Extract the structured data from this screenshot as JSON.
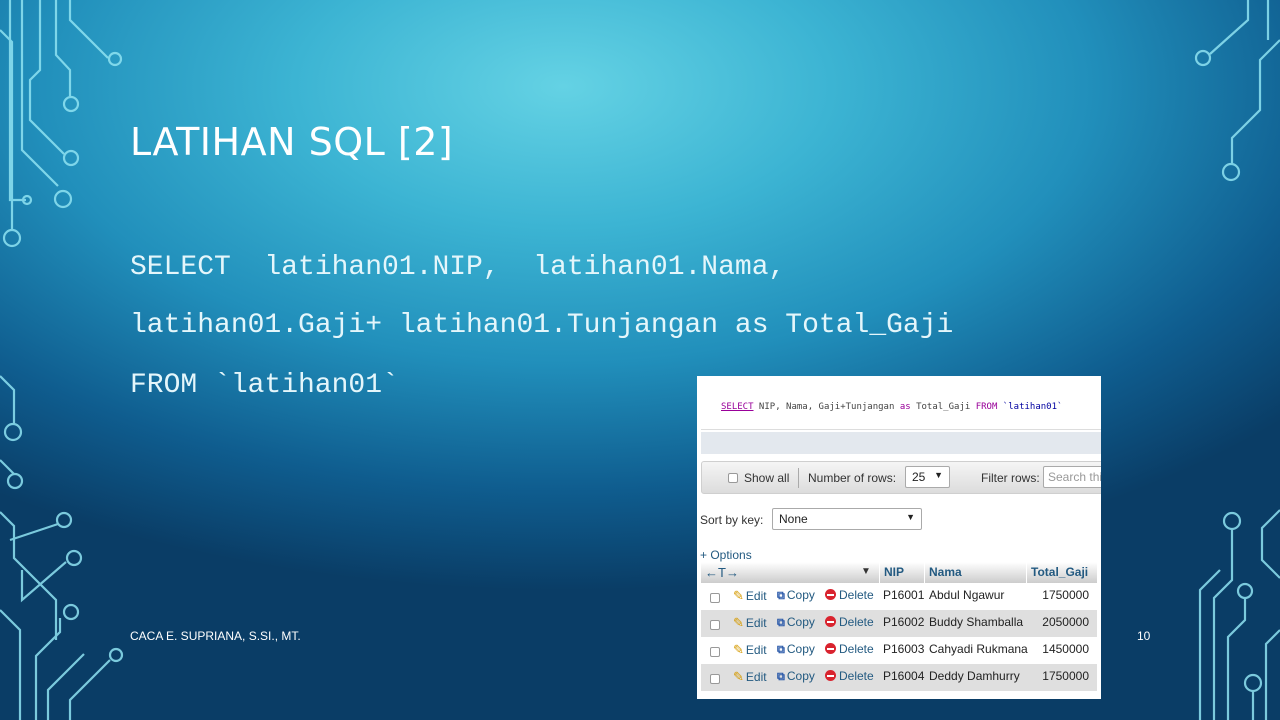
{
  "slide": {
    "title": "LATIHAN SQL [2]",
    "code_lines": [
      "SELECT  latihan01.NIP,  latihan01.Nama,",
      "latihan01.Gaji+ latihan01.Tunjangan as Total_Gaji",
      "FROM `latihan01`"
    ],
    "footer_author": "CACA E. SUPRIANA, S.SI., MT.",
    "page_number": "10"
  },
  "screenshot": {
    "sql_query": {
      "select_kw": "SELECT",
      "columns": " NIP, Nama, Gaji+Tunjangan ",
      "as_kw": "as",
      "alias": " Total_Gaji ",
      "from_kw": "FROM",
      "table": " `latihan01`"
    },
    "nav": {
      "show_all_label": "Show all",
      "number_of_rows_label": "Number of rows:",
      "rows_value": "25",
      "filter_rows_label": "Filter rows:",
      "search_placeholder": "Search this table"
    },
    "sort_by_key_label": "Sort by key:",
    "sort_by_key_value": "None",
    "options_link": "+ Options",
    "column_arrows": "←T→",
    "columns": [
      "NIP",
      "Nama",
      "Total_Gaji"
    ],
    "actions": {
      "edit": "Edit",
      "copy": "Copy",
      "delete": "Delete"
    },
    "rows": [
      {
        "nip": "P16001",
        "nama": "Abdul Ngawur",
        "total_gaji": "1750000"
      },
      {
        "nip": "P16002",
        "nama": "Buddy Shamballa",
        "total_gaji": "2050000"
      },
      {
        "nip": "P16003",
        "nama": "Cahyadi Rukmana",
        "total_gaji": "1450000"
      },
      {
        "nip": "P16004",
        "nama": "Deddy Damhurry",
        "total_gaji": "1750000"
      }
    ]
  },
  "icons": [
    "circuit-decoration",
    "pencil-icon",
    "copy-icon",
    "delete-icon",
    "sort-arrow-icon",
    "dropdown-arrow-icon"
  ],
  "colors": {
    "background_top": "#64d2e4",
    "background_bottom": "#0a3d66",
    "link": "#235a81",
    "sql_keyword": "#990099",
    "delete_icon": "#d9232e"
  }
}
